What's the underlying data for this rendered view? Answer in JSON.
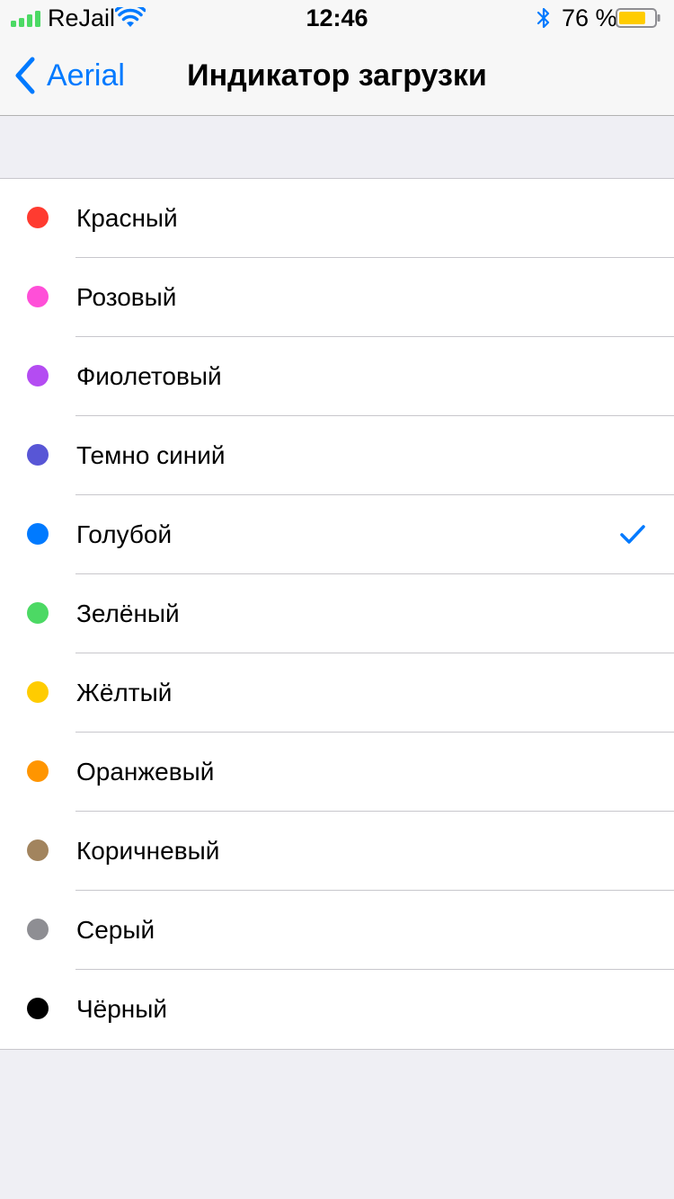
{
  "status_bar": {
    "carrier": "ReJail",
    "time": "12:46",
    "battery_percent": "76 %",
    "battery_level": 0.76,
    "signal_bars": 4,
    "icons": [
      "signal-icon",
      "wifi-icon",
      "bluetooth-icon",
      "battery-icon"
    ],
    "colors": {
      "signal": "#4cd964",
      "wifi": "#007aff",
      "bluetooth": "#007aff",
      "battery_fill": "#ffcc00"
    }
  },
  "nav": {
    "back_label": "Aerial",
    "title": "Индикатор загрузки",
    "accent": "#007aff"
  },
  "colors_list": {
    "selected_index": 4,
    "check_color": "#007aff",
    "items": [
      {
        "label": "Красный",
        "color": "#ff3b30"
      },
      {
        "label": "Розовый",
        "color": "#ff4fd8"
      },
      {
        "label": "Фиолетовый",
        "color": "#b44cf2"
      },
      {
        "label": "Темно синий",
        "color": "#5856d6"
      },
      {
        "label": "Голубой",
        "color": "#007aff"
      },
      {
        "label": "Зелёный",
        "color": "#4cd964"
      },
      {
        "label": "Жёлтый",
        "color": "#ffcc00"
      },
      {
        "label": "Оранжевый",
        "color": "#ff9500"
      },
      {
        "label": "Коричневый",
        "color": "#a2845e"
      },
      {
        "label": "Серый",
        "color": "#8e8e93"
      },
      {
        "label": "Чёрный",
        "color": "#000000"
      }
    ]
  }
}
